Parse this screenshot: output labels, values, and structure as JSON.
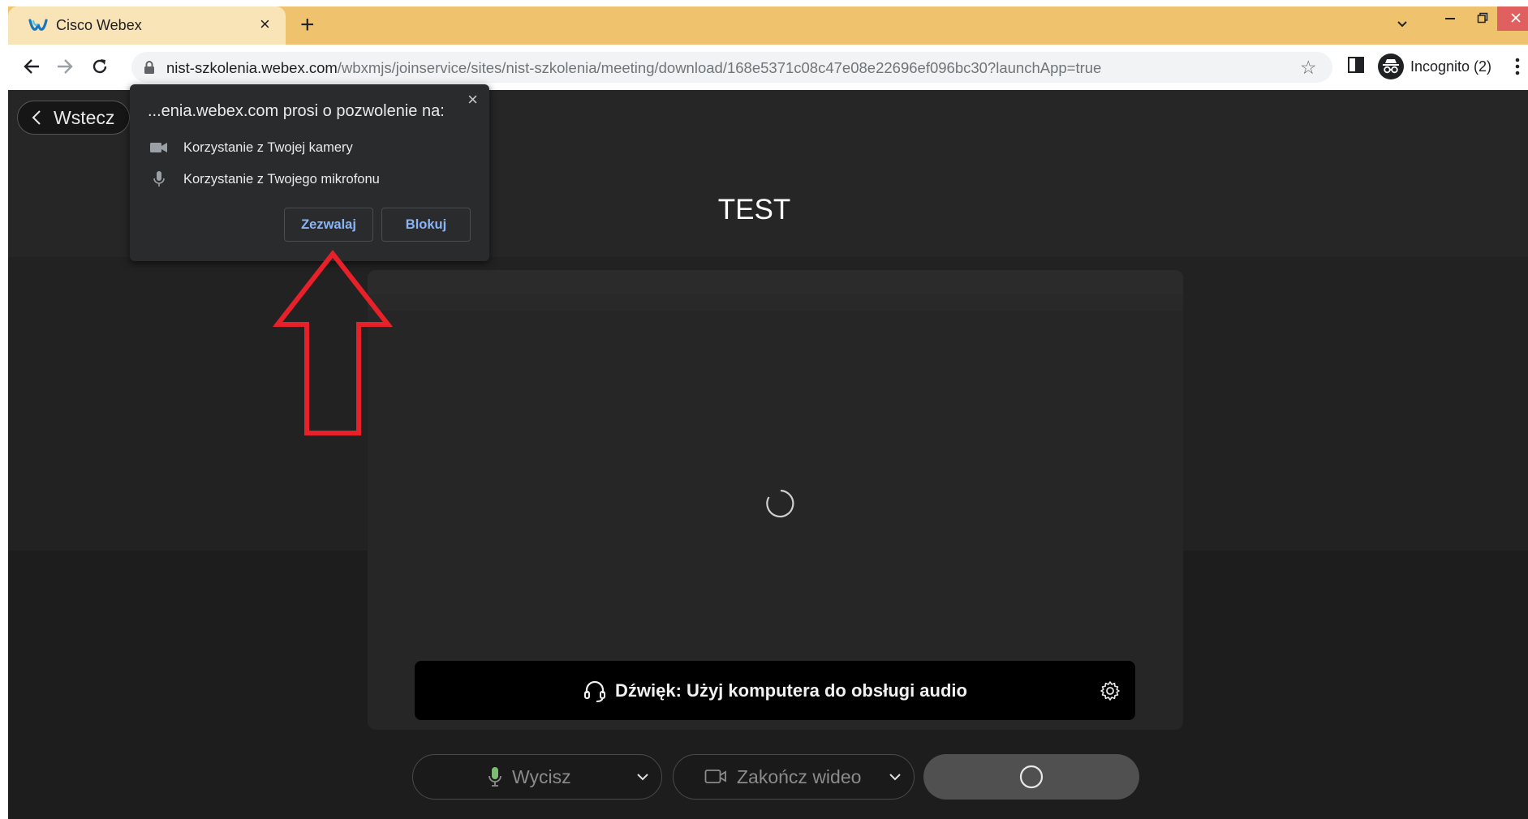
{
  "browser": {
    "tab_title": "Cisco Webex",
    "tab_close": "×",
    "new_tab": "+",
    "url_host": "nist-szkolenia.webex.com",
    "url_path": "/wbxmjs/joinservice/sites/nist-szkolenia/meeting/download/168e5371c08c47e08e22696ef096bc30?launchApp=true",
    "profile_label": "Incognito (2)"
  },
  "permission_popup": {
    "title": "...enia.webex.com prosi o pozwolenie na:",
    "camera_text": "Korzystanie z Twojej kamery",
    "mic_text": "Korzystanie z Twojego mikrofonu",
    "allow_label": "Zezwalaj",
    "block_label": "Blokuj",
    "close": "×"
  },
  "page": {
    "back_label": "Wstecz",
    "meeting_title": "TEST",
    "audio_label": "Dźwięk: Użyj komputera do obsługi audio",
    "mute_label": "Wycisz",
    "video_label": "Zakończ wideo"
  },
  "colors": {
    "tab_strip": "#efc36d",
    "annotation_arrow": "#e8202a",
    "link_button_text": "#8ab4f8"
  }
}
